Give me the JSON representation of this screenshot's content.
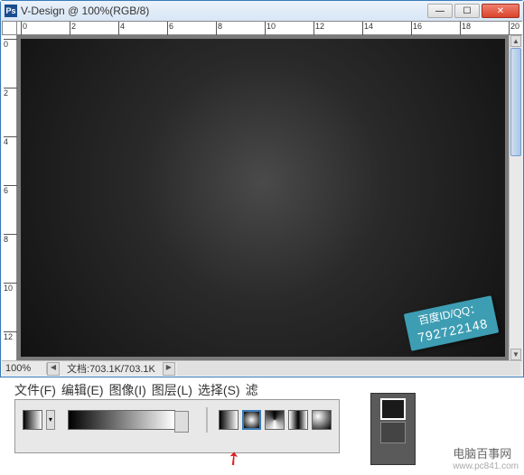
{
  "window": {
    "title": "V-Design @ 100%(RGB/8)",
    "app_icon_text": "Ps"
  },
  "ruler_h": [
    "0",
    "2",
    "4",
    "6",
    "8",
    "10",
    "12",
    "14",
    "16",
    "18",
    "20"
  ],
  "ruler_v": [
    "0",
    "2",
    "4",
    "6",
    "8",
    "10",
    "12"
  ],
  "statusbar": {
    "zoom": "100%",
    "docinfo_label": "文档:",
    "docinfo_value": "703.1K/703.1K"
  },
  "watermark": {
    "line1": "百度ID/QQ：",
    "line2": "792722148"
  },
  "menus": [
    "文件(F)",
    "编辑(E)",
    "图像(I)",
    "图层(L)",
    "选择(S)",
    "滤"
  ],
  "brand": {
    "cn": "电脑百事网",
    "url": "www.pc841.com"
  }
}
